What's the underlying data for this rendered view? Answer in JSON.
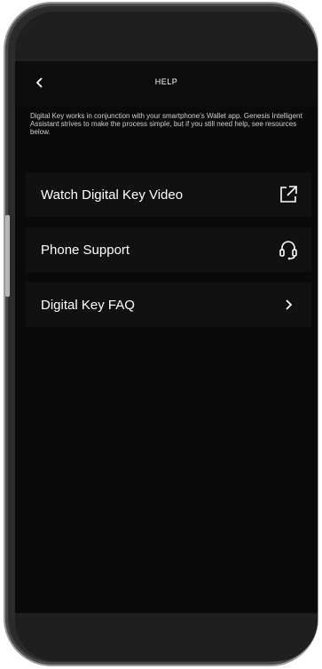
{
  "header": {
    "title": "HELP",
    "back_icon": "chevron-left-icon"
  },
  "intro": {
    "text": "Digital Key works in conjunction with your smartphone's Wallet app. Genesis Intelligent Assistant strives to make the process simple, but if you still need help, see resources below."
  },
  "menu": {
    "items": [
      {
        "label": "Watch Digital Key Video",
        "icon": "external-link-icon"
      },
      {
        "label": "Phone Support",
        "icon": "headset-icon"
      },
      {
        "label": "Digital Key FAQ",
        "icon": "chevron-right-icon"
      }
    ]
  },
  "colors": {
    "background": "#0a0a0a",
    "row_background": "#111111",
    "text": "#ffffff",
    "secondary_text": "#d0d0d0"
  }
}
